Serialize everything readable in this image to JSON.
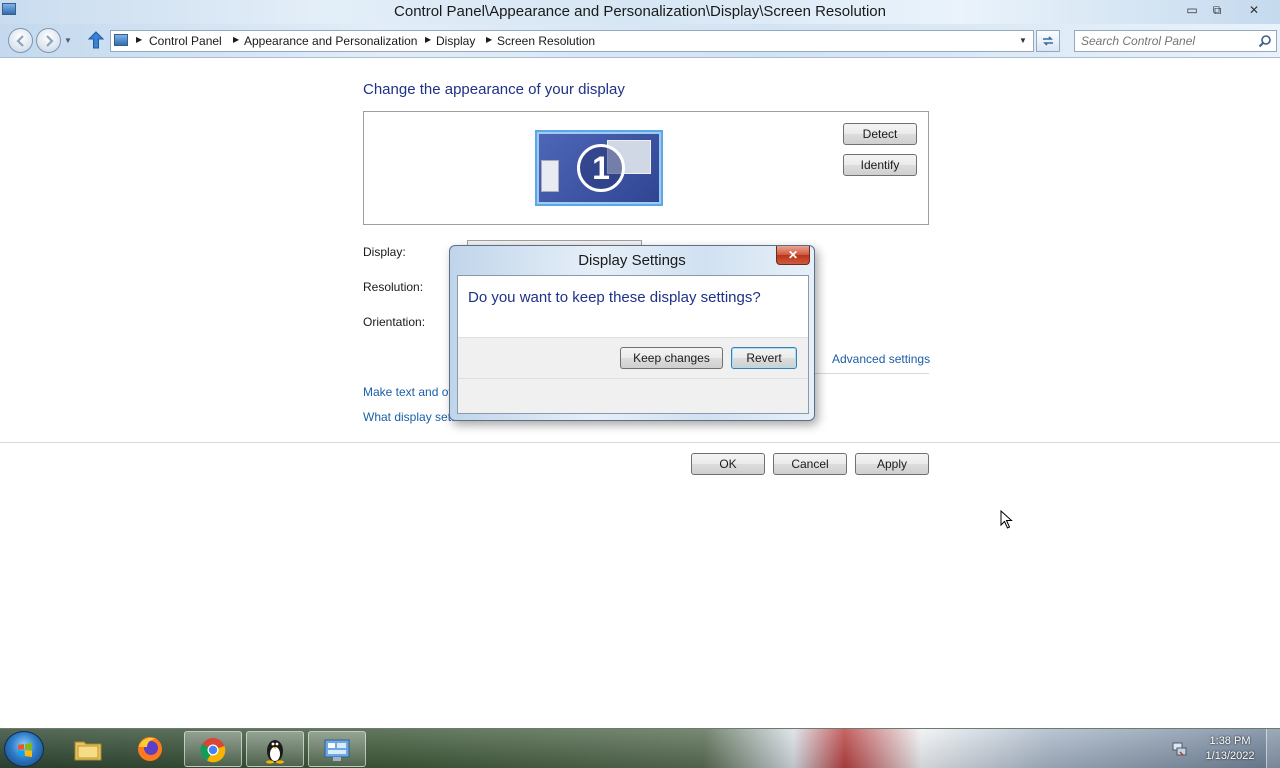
{
  "window": {
    "title": "Control Panel\\Appearance and Personalization\\Display\\Screen Resolution",
    "controls": {
      "minimize": "▭",
      "maximize": "⧉",
      "close": "✕"
    }
  },
  "address": {
    "crumbs": [
      "Control Panel",
      "Appearance and Personalization",
      "Display",
      "Screen Resolution"
    ],
    "search_placeholder": "Search Control Panel"
  },
  "main": {
    "heading": "Change the appearance of your display",
    "monitor_number": "1",
    "detect_label": "Detect",
    "identify_label": "Identify",
    "display_label": "Display:",
    "resolution_label": "Resolution:",
    "orientation_label": "Orientation:",
    "advanced_link": "Advanced settings",
    "make_text_link": "Make text and other items larger or smaller",
    "what_settings_link": "What display settings should I choose?",
    "ok_label": "OK",
    "cancel_label": "Cancel",
    "apply_label": "Apply"
  },
  "dialog": {
    "title": "Display Settings",
    "question": "Do you want to keep these display settings?",
    "keep_label": "Keep changes",
    "revert_label": "Revert",
    "close_glyph": "✕"
  },
  "taskbar": {
    "apps": [
      "file-explorer-icon",
      "firefox-icon",
      "chrome-icon",
      "tux-penguin-icon",
      "control-panel-icon"
    ],
    "active_app": "control-panel-icon",
    "time": "1:38 PM",
    "date": "1/13/2022"
  },
  "colors": {
    "heading_blue": "#1e3287",
    "link_blue": "#1a5fa8",
    "close_red": "#c9462a"
  }
}
